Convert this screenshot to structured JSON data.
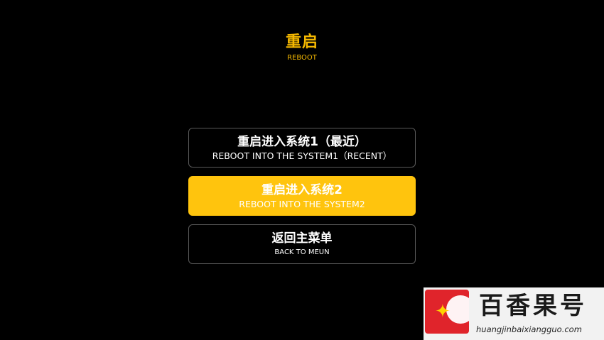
{
  "header": {
    "title": "重启",
    "subtitle": "REBOOT"
  },
  "menu": {
    "items": [
      {
        "label": "重启进入系统1（最近）",
        "sublabel": "REBOOT INTO THE SYSTEM1（RECENT）",
        "selected": false
      },
      {
        "label": "重启进入系统2",
        "sublabel": "REBOOT INTO THE SYSTEM2",
        "selected": true
      },
      {
        "label": "返回主菜单",
        "sublabel": "BACK TO MEUN",
        "selected": false
      }
    ]
  },
  "watermark": {
    "brand": "百香果号",
    "url": "huangjinbaixiangguo.com"
  },
  "colors": {
    "accent": "#ffc40d",
    "title": "#f5b800",
    "background": "#000000",
    "border": "#5a5a5a"
  }
}
